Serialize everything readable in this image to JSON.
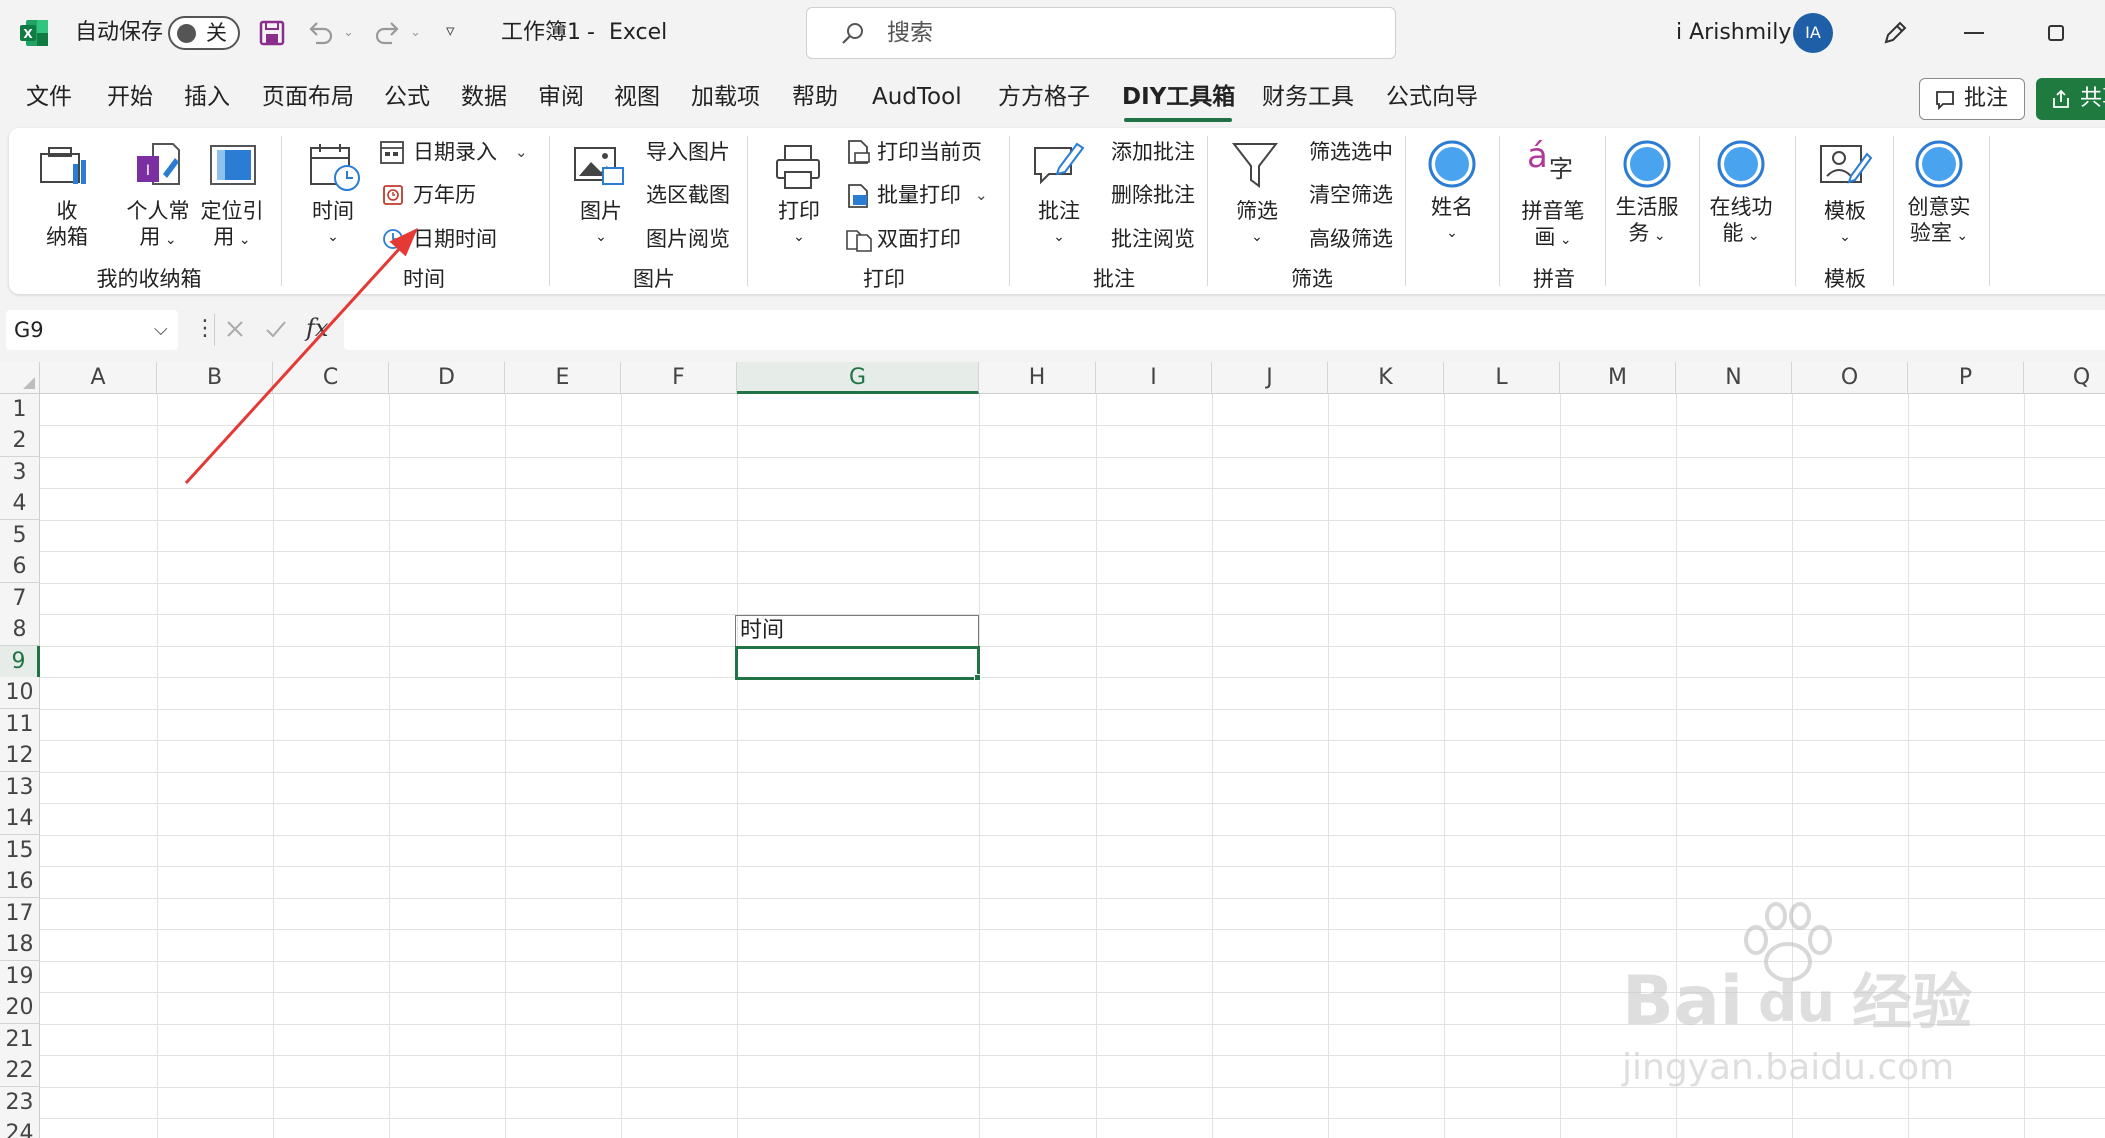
{
  "titlebar": {
    "autosave_label": "自动保存",
    "autosave_state": "关",
    "doc_title": "工作簿1",
    "title_sep": "-",
    "app_name": "Excel",
    "search_placeholder": "搜索",
    "user_name": "i Arishmily",
    "avatar_initials": "IA"
  },
  "tabs": [
    {
      "label": "文件"
    },
    {
      "label": "开始"
    },
    {
      "label": "插入"
    },
    {
      "label": "页面布局"
    },
    {
      "label": "公式"
    },
    {
      "label": "数据"
    },
    {
      "label": "审阅"
    },
    {
      "label": "视图"
    },
    {
      "label": "加载项"
    },
    {
      "label": "帮助"
    },
    {
      "label": "AudTool"
    },
    {
      "label": "方方格子"
    },
    {
      "label": "DIY工具箱"
    },
    {
      "label": "财务工具"
    },
    {
      "label": "公式向导"
    }
  ],
  "active_tab": "DIY工具箱",
  "header_actions": {
    "comments_label": "批注",
    "share_label": "共享"
  },
  "ribbon": {
    "storage": {
      "group_label": "我的收纳箱",
      "box_line1": "收",
      "box_line2": "纳箱",
      "personal_line1": "个人常",
      "personal_line2": "用",
      "locate_line1": "定位引",
      "locate_line2": "用"
    },
    "time": {
      "group_label": "时间",
      "time_big": "时间",
      "date_entry": "日期录入",
      "calendar": "万年历",
      "datetime": "日期时间"
    },
    "picture": {
      "group_label": "图片",
      "picture_big": "图片",
      "import_picture": "导入图片",
      "area_screenshot": "选区截图",
      "picture_browse": "图片阅览"
    },
    "print": {
      "group_label": "打印",
      "print_big": "打印",
      "print_current": "打印当前页",
      "batch_print": "批量打印",
      "duplex_print": "双面打印"
    },
    "comment": {
      "group_label": "批注",
      "comment_big": "批注",
      "add_comment": "添加批注",
      "delete_comment": "删除批注",
      "browse_comment": "批注阅览"
    },
    "filter": {
      "group_label": "筛选",
      "filter_big": "筛选",
      "filter_selected": "筛选选中",
      "clear_filter": "清空筛选",
      "advanced_filter": "高级筛选"
    },
    "name_label": "姓名",
    "pinyin": {
      "group_label": "拼音",
      "stroke_line1": "拼音笔",
      "stroke_line2": "画"
    },
    "life_line1": "生活服",
    "life_line2": "务",
    "online_line1": "在线功",
    "online_line2": "能",
    "template": {
      "group_label": "模板",
      "template_big": "模板"
    },
    "lab_line1": "创意实",
    "lab_line2": "验室"
  },
  "formula_bar": {
    "name_box": "G9",
    "fx": "fx",
    "formula": ""
  },
  "grid": {
    "columns": [
      "A",
      "B",
      "C",
      "D",
      "E",
      "F",
      "G",
      "H",
      "I",
      "J",
      "K",
      "L",
      "M",
      "N",
      "O",
      "P",
      "Q"
    ],
    "rows": [
      "1",
      "2",
      "3",
      "4",
      "5",
      "6",
      "7",
      "8",
      "9",
      "10",
      "11",
      "12",
      "13",
      "14",
      "15",
      "16",
      "17",
      "18",
      "19",
      "20",
      "21",
      "22",
      "23",
      "24"
    ],
    "selected_column": "G",
    "selected_row": "9",
    "cells": {
      "G8": "时间",
      "G9": ""
    }
  },
  "watermark": {
    "line1": "Bai",
    "line2": "du",
    "line3": "经验",
    "url": "jingyan.baidu.com"
  },
  "colors": {
    "accent": "#217346",
    "share": "#1e7a3e",
    "annotation_arrow": "#e53935",
    "icon_blue": "#2b7cd3"
  }
}
